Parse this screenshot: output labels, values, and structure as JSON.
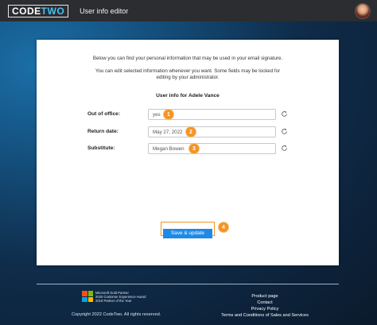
{
  "app": {
    "logo_part1": "CODE",
    "logo_part2": "TWO",
    "title": "User info editor"
  },
  "panel": {
    "intro_line1": "Below you can find your personal information that may be used in your email signature.",
    "intro_line2a": "You can edit selected information whenever you want. Some fields may be locked for",
    "intro_line2b": "editing by your administrator.",
    "user_heading": "User info for Adele Vance",
    "fields": [
      {
        "label": "Out of office:",
        "value": "yes",
        "badge": "1"
      },
      {
        "label": "Return date:",
        "value": "May 27, 2022",
        "badge": "2"
      },
      {
        "label": "Substitute:",
        "value": "Megan Bowen",
        "badge": "3"
      }
    ],
    "save_label": "Save & update",
    "save_badge": "4"
  },
  "footer": {
    "partner_line1": "Microsoft Gold Partner",
    "partner_line2": "2020 Customer Experience Award",
    "partner_line3": "2019 Partner of the Year",
    "copyright": "Copyright 2022 CodeTwo. All rights reserved.",
    "links": [
      "Product page",
      "Contact",
      "Privacy Policy",
      "Terms and Conditions of Sales and Services"
    ]
  },
  "colors": {
    "accent": "#1f8ae6",
    "badge": "#f39425",
    "topbar": "#2b2d30",
    "logo_accent": "#48c0f0"
  }
}
